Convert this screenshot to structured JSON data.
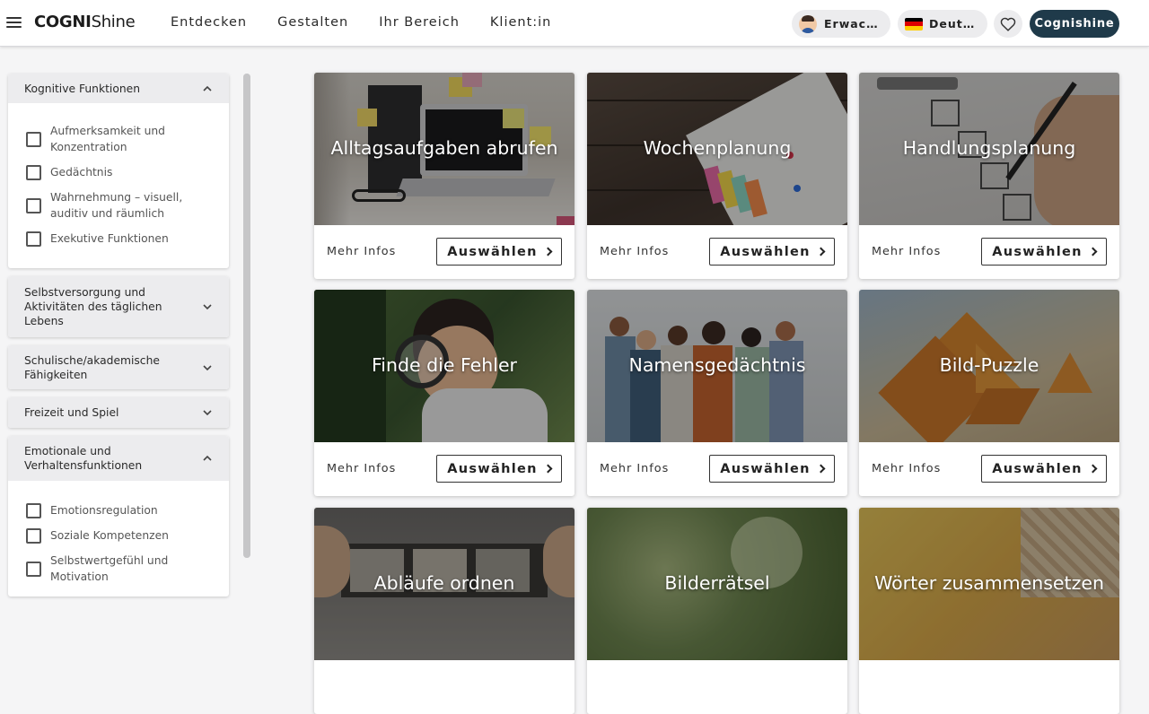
{
  "header": {
    "logo_bold": "COGNI",
    "logo_rest": "Shine",
    "nav": [
      "Entdecken",
      "Gestalten",
      "Ihr Bereich",
      "Klient:in"
    ],
    "user_label": "Erwachsene",
    "language_label": "Deutsch",
    "brand_button": "Cognishine"
  },
  "sidebar": {
    "sections": [
      {
        "title": "Kognitive Funktionen",
        "expanded": true,
        "options": [
          "Aufmerksamkeit und Konzentration",
          "Gedächtnis",
          "Wahrnehmung – visuell, auditiv und räumlich",
          "Exekutive Funktionen"
        ]
      },
      {
        "title": "Selbstversorgung und Aktivitäten des täglichen Lebens",
        "expanded": false,
        "options": []
      },
      {
        "title": "Schulische/akademische Fähigkeiten",
        "expanded": false,
        "options": []
      },
      {
        "title": "Freizeit und Spiel",
        "expanded": false,
        "options": []
      },
      {
        "title": "Emotionale und Verhaltensfunktionen",
        "expanded": true,
        "options": [
          "Emotionsregulation",
          "Soziale Kompetenzen",
          "Selbstwertgefühl und Motivation"
        ]
      }
    ]
  },
  "cards": {
    "more_label": "Mehr Infos",
    "select_label": "Auswählen",
    "titles": [
      "Alltagsaufgaben abrufen",
      "Wochenplanung",
      "Handlungsplanung",
      "Finde die Fehler",
      "Namensgedächtnis",
      "Bild-Puzzle",
      "Abläufe ordnen",
      "Bilderrätsel",
      "Wörter zusammensetzen"
    ]
  },
  "colors": {
    "brand": "#1f3a4a",
    "pill_bg": "#ececee",
    "page_bg": "#f5f5f6"
  }
}
